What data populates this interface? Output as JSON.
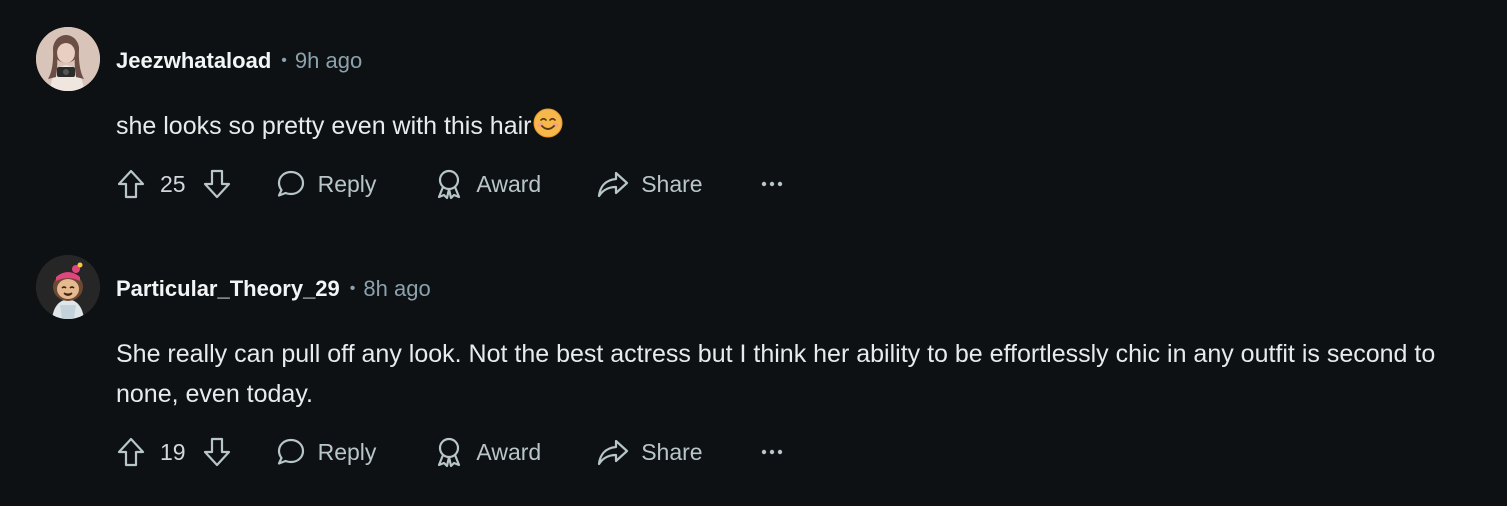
{
  "comments": [
    {
      "username": "Jeezwhataload",
      "separator": "•",
      "time": "9h ago",
      "text": "she looks so pretty even with this hair",
      "emoji": "smiling-face-emoji",
      "votes": "25",
      "reply_label": "Reply",
      "award_label": "Award",
      "share_label": "Share",
      "more_label": "•••"
    },
    {
      "username": "Particular_Theory_29",
      "separator": "•",
      "time": "8h ago",
      "text": "She really can pull off any look. Not the best actress but I think her ability to be effortlessly chic in any outfit is second to none, even today.",
      "votes": "19",
      "reply_label": "Reply",
      "award_label": "Award",
      "share_label": "Share",
      "more_label": "•••"
    }
  ],
  "icons": {
    "upvote": "upvote-arrow-icon",
    "downvote": "downvote-arrow-icon",
    "reply": "speech-bubble-icon",
    "award": "award-ribbon-icon",
    "share": "share-arrow-icon",
    "more": "more-dots-icon"
  },
  "colors": {
    "background": "#0e1113",
    "text": "#e8eaeb",
    "muted": "#8ba2ad",
    "action": "#b8c5c9"
  }
}
